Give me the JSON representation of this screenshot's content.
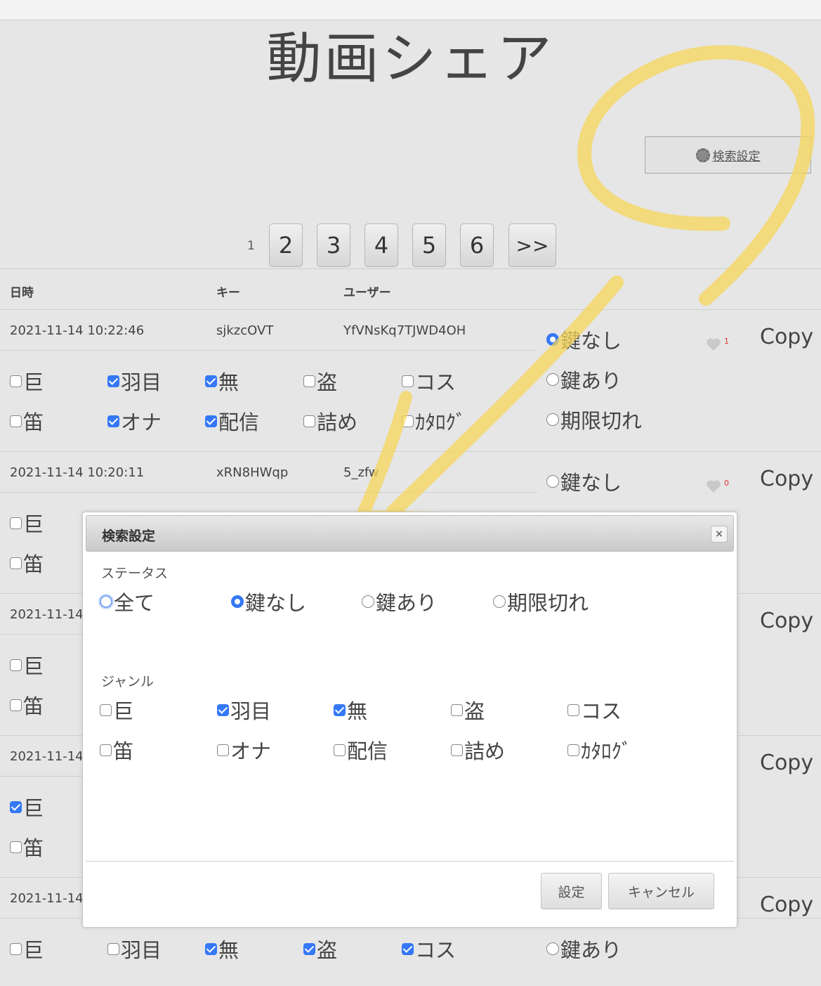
{
  "app_title": "動画シェア",
  "search_button_label": "検索設定",
  "pager": {
    "current": "1",
    "pages": [
      "2",
      "3",
      "4",
      "5",
      "6"
    ],
    "next": ">>"
  },
  "table_headers": {
    "datetime": "日時",
    "key": "キー",
    "user": "ユーザー"
  },
  "copy_label": "Copy",
  "rows": [
    {
      "datetime": "2021-11-14 10:22:46",
      "key": "sjkzcOVT",
      "user": "YfVNsKq7TJWD4OH",
      "likes": "1",
      "genres": [
        {
          "label": "巨",
          "checked": false
        },
        {
          "label": "羽目",
          "checked": true
        },
        {
          "label": "無",
          "checked": true
        },
        {
          "label": "盗",
          "checked": false
        },
        {
          "label": "コス",
          "checked": false
        },
        {
          "label": "笛",
          "checked": false
        },
        {
          "label": "オナ",
          "checked": true
        },
        {
          "label": "配信",
          "checked": true
        },
        {
          "label": "詰め",
          "checked": false
        },
        {
          "label": "ｶﾀﾛｸﾞ",
          "checked": false
        }
      ],
      "status": [
        {
          "label": "鍵なし",
          "selected": true
        },
        {
          "label": "鍵あり",
          "selected": false
        },
        {
          "label": "期限切れ",
          "selected": false
        }
      ]
    },
    {
      "datetime": "2021-11-14 10:20:11",
      "key": "xRN8HWqp",
      "user": "5_zfw",
      "likes": "0",
      "genres": [
        {
          "label": "巨",
          "checked": false
        },
        {
          "label": "笛",
          "checked": false
        }
      ],
      "status": [
        {
          "label": "鍵なし",
          "selected": false
        }
      ]
    },
    {
      "datetime": "2021-11-14",
      "genres": [
        {
          "label": "巨",
          "checked": false
        },
        {
          "label": "笛",
          "checked": false
        }
      ]
    },
    {
      "datetime": "2021-11-14",
      "genres": [
        {
          "label": "巨",
          "checked": true
        },
        {
          "label": "笛",
          "checked": false
        }
      ]
    },
    {
      "datetime": "2021-11-14",
      "genres": [
        {
          "label": "巨",
          "checked": false
        },
        {
          "label": "羽目",
          "checked": false
        },
        {
          "label": "無",
          "checked": true
        },
        {
          "label": "盗",
          "checked": true
        },
        {
          "label": "コス",
          "checked": true
        }
      ],
      "status": [
        {
          "label": "鍵あり",
          "selected": false
        }
      ]
    }
  ],
  "modal": {
    "title": "検索設定",
    "close_icon": "×",
    "status_label": "ステータス",
    "status_options": [
      {
        "label": "全て",
        "selected": false
      },
      {
        "label": "鍵なし",
        "selected": true
      },
      {
        "label": "鍵あり",
        "selected": false
      },
      {
        "label": "期限切れ",
        "selected": false
      }
    ],
    "genre_label": "ジャンル",
    "genre_options": [
      {
        "label": "巨",
        "checked": false
      },
      {
        "label": "羽目",
        "checked": true
      },
      {
        "label": "無",
        "checked": true
      },
      {
        "label": "盗",
        "checked": false
      },
      {
        "label": "コス",
        "checked": false
      },
      {
        "label": "笛",
        "checked": false
      },
      {
        "label": "オナ",
        "checked": false
      },
      {
        "label": "配信",
        "checked": false
      },
      {
        "label": "詰め",
        "checked": false
      },
      {
        "label": "ｶﾀﾛｸﾞ",
        "checked": false
      }
    ],
    "ok_label": "設定",
    "cancel_label": "キャンセル"
  },
  "colors": {
    "accent": "#3478f6",
    "highlight": "#f5d55a",
    "background": "#e6e6e6"
  },
  "icons": {
    "search_button": "gear-icon",
    "like": "heart-icon",
    "close": "close-icon"
  }
}
